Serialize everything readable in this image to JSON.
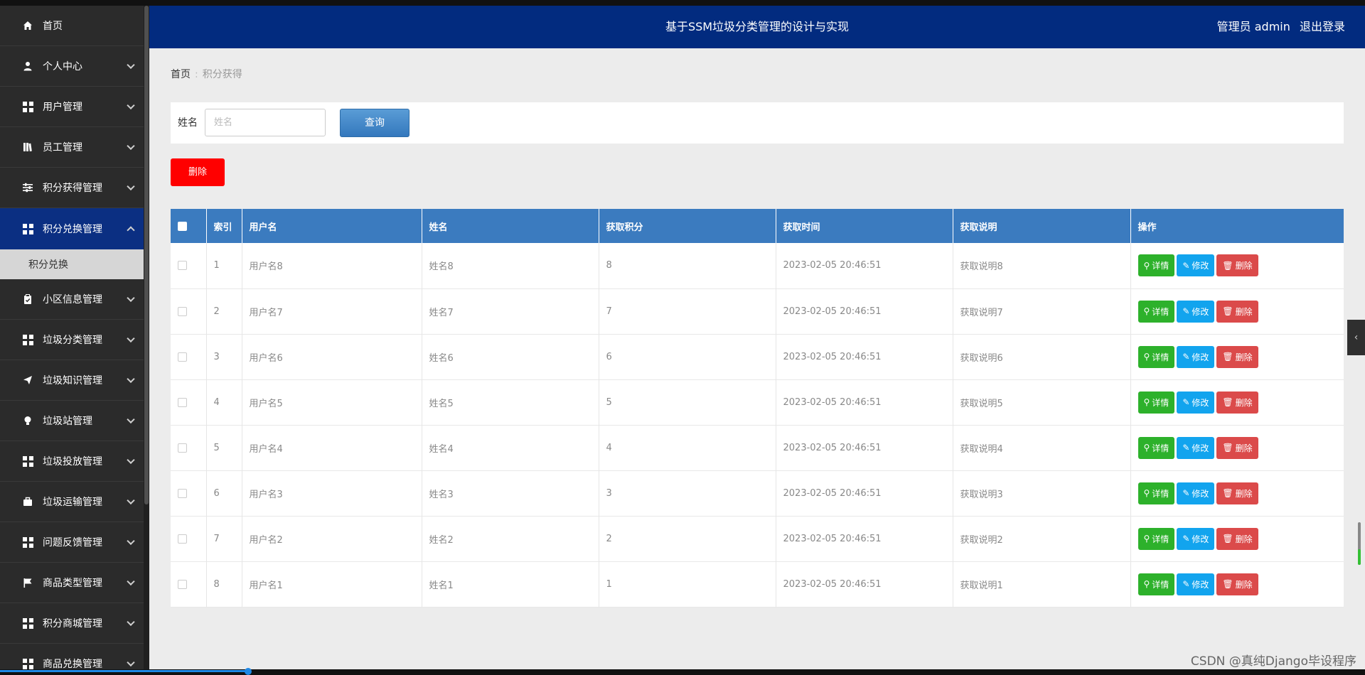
{
  "header": {
    "title": "基于SSM垃圾分类管理的设计与实现",
    "user_label": "管理员 admin",
    "logout": "退出登录"
  },
  "sidebar": {
    "items": [
      {
        "label": "首页",
        "icon": "home-icon",
        "has_chevron": false
      },
      {
        "label": "个人中心",
        "icon": "user-icon",
        "has_chevron": true
      },
      {
        "label": "用户管理",
        "icon": "grid-icon",
        "has_chevron": true
      },
      {
        "label": "员工管理",
        "icon": "book-icon",
        "has_chevron": true
      },
      {
        "label": "积分获得管理",
        "icon": "sliders-icon",
        "has_chevron": true
      },
      {
        "label": "积分兑换管理",
        "icon": "grid-icon",
        "has_chevron": true,
        "active": true
      },
      {
        "label": "小区信息管理",
        "icon": "clipboard-icon",
        "has_chevron": true
      },
      {
        "label": "垃圾分类管理",
        "icon": "grid-icon",
        "has_chevron": true
      },
      {
        "label": "垃圾知识管理",
        "icon": "send-icon",
        "has_chevron": true
      },
      {
        "label": "垃圾站管理",
        "icon": "bulb-icon",
        "has_chevron": true
      },
      {
        "label": "垃圾投放管理",
        "icon": "grid-icon",
        "has_chevron": true
      },
      {
        "label": "垃圾运输管理",
        "icon": "briefcase-icon",
        "has_chevron": true
      },
      {
        "label": "问题反馈管理",
        "icon": "grid-icon",
        "has_chevron": true
      },
      {
        "label": "商品类型管理",
        "icon": "flag-icon",
        "has_chevron": true
      },
      {
        "label": "积分商城管理",
        "icon": "grid-icon",
        "has_chevron": true
      },
      {
        "label": "商品兑换管理",
        "icon": "grid-icon",
        "has_chevron": true
      }
    ],
    "sub_item": "积分兑换"
  },
  "breadcrumb": {
    "home": "首页",
    "separator": ":",
    "current": "积分获得"
  },
  "search": {
    "label": "姓名",
    "placeholder": "姓名",
    "button": "查询"
  },
  "delete_button": "删除",
  "table": {
    "headers": [
      "索引",
      "用户名",
      "姓名",
      "获取积分",
      "获取时间",
      "获取说明",
      "操作"
    ],
    "rows": [
      {
        "index": "1",
        "username": "用户名8",
        "name": "姓名8",
        "points": "8",
        "time": "2023-02-05 20:46:51",
        "desc": "获取说明8"
      },
      {
        "index": "2",
        "username": "用户名7",
        "name": "姓名7",
        "points": "7",
        "time": "2023-02-05 20:46:51",
        "desc": "获取说明7"
      },
      {
        "index": "3",
        "username": "用户名6",
        "name": "姓名6",
        "points": "6",
        "time": "2023-02-05 20:46:51",
        "desc": "获取说明6"
      },
      {
        "index": "4",
        "username": "用户名5",
        "name": "姓名5",
        "points": "5",
        "time": "2023-02-05 20:46:51",
        "desc": "获取说明5"
      },
      {
        "index": "5",
        "username": "用户名4",
        "name": "姓名4",
        "points": "4",
        "time": "2023-02-05 20:46:51",
        "desc": "获取说明4"
      },
      {
        "index": "6",
        "username": "用户名3",
        "name": "姓名3",
        "points": "3",
        "time": "2023-02-05 20:46:51",
        "desc": "获取说明3"
      },
      {
        "index": "7",
        "username": "用户名2",
        "name": "姓名2",
        "points": "2",
        "time": "2023-02-05 20:46:51",
        "desc": "获取说明2"
      },
      {
        "index": "8",
        "username": "用户名1",
        "name": "姓名1",
        "points": "1",
        "time": "2023-02-05 20:46:51",
        "desc": "获取说明1"
      }
    ],
    "actions": {
      "detail": "详情",
      "edit": "修改",
      "delete": "删除"
    }
  },
  "colors": {
    "header": "#022b7f",
    "sidebar": "#2b2b2b",
    "sidebar_active": "#0b2f82",
    "table_head": "#3b7bbf",
    "detail": "#2db12b",
    "edit": "#12a4ee",
    "delete": "#db4a4a",
    "delete_top": "#ff0000"
  },
  "watermark": "CSDN @真纯Django毕设程序"
}
